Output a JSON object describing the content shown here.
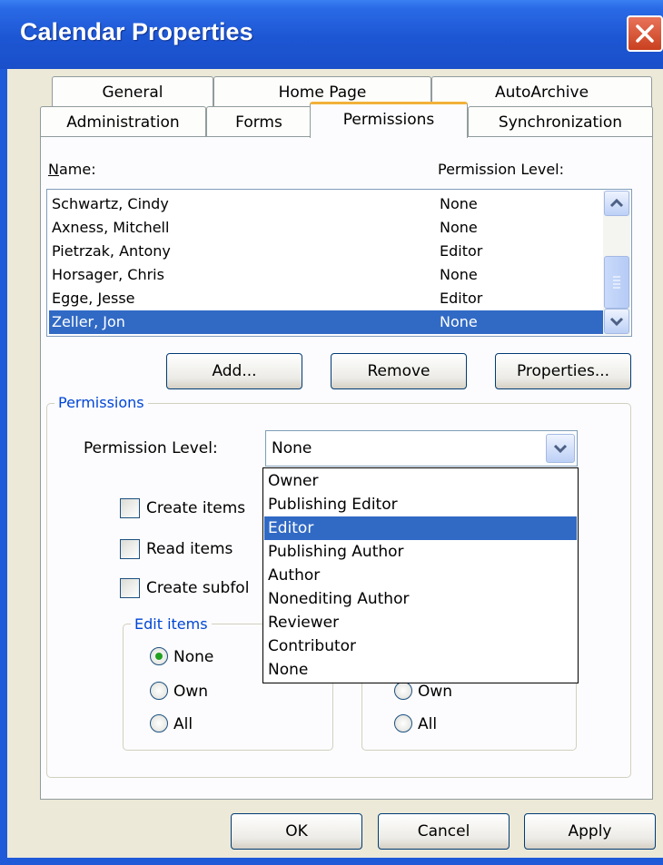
{
  "window": {
    "title": "Calendar Properties"
  },
  "tabs": {
    "row_back": [
      "General",
      "Home Page",
      "AutoArchive"
    ],
    "row_front": [
      "Administration",
      "Forms",
      "Permissions",
      "Synchronization"
    ],
    "active": "Permissions"
  },
  "list": {
    "name_header": "Name:",
    "level_header": "Permission Level:",
    "rows": [
      {
        "name": "Schwartz, Cindy",
        "level": "None"
      },
      {
        "name": "Axness, Mitchell",
        "level": "None"
      },
      {
        "name": "Pietrzak, Antony",
        "level": "Editor"
      },
      {
        "name": "Horsager, Chris",
        "level": "None"
      },
      {
        "name": "Egge, Jesse",
        "level": "Editor"
      },
      {
        "name": "Zeller, Jon",
        "level": "None"
      }
    ],
    "selected_index": 5
  },
  "buttons": {
    "add": "Add...",
    "remove": "Remove",
    "properties": "Properties..."
  },
  "permissions": {
    "group_label": "Permissions",
    "level_label": "Permission Level:",
    "level_value": "None",
    "create_items": "Create items",
    "read_items": "Read items",
    "create_subfolders": "Create subfol",
    "edit_items": {
      "label": "Edit items",
      "none": "None",
      "own": "Own",
      "all": "All",
      "selected": "None"
    },
    "delete_items": {
      "own": "Own",
      "all": "All"
    }
  },
  "dropdown": {
    "options": [
      "Owner",
      "Publishing Editor",
      "Editor",
      "Publishing Author",
      "Author",
      "Nonediting Author",
      "Reviewer",
      "Contributor",
      "None"
    ],
    "highlighted": "Editor"
  },
  "footer": {
    "ok": "OK",
    "cancel": "Cancel",
    "apply": "Apply"
  },
  "icons": [
    "close-icon",
    "scroll-up-icon",
    "scroll-down-icon",
    "dropdown-arrow-icon",
    "radio-selected-icon"
  ],
  "colors": {
    "titlebar": "#2a6ae6",
    "selection": "#316ac5",
    "close": "#d9532f",
    "active_tab_accent": "#f3b13a",
    "group_label": "#0046d5"
  }
}
